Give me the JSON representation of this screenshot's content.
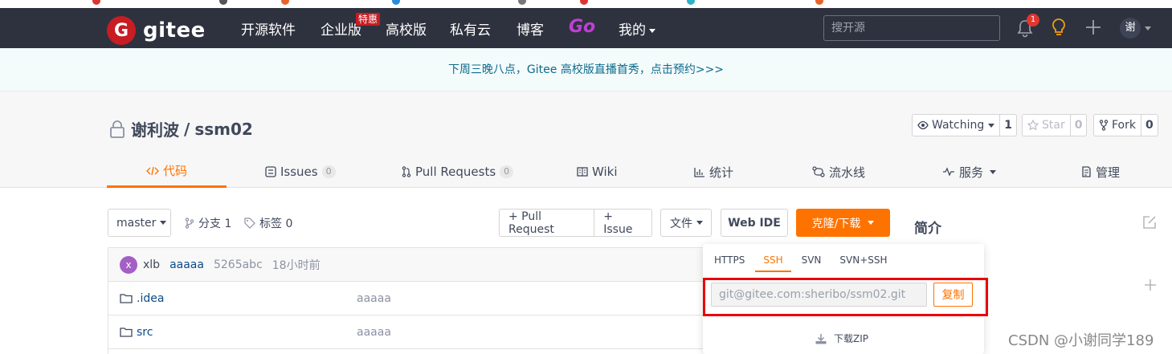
{
  "navbar": {
    "logo_mark": "G",
    "logo_text": "gitee",
    "items": [
      "开源软件",
      "企业版",
      "高校版",
      "私有云",
      "博客"
    ],
    "hot_badge": "特惠",
    "go_label": "Go",
    "mine_label": "我的",
    "search_placeholder": "搜开源",
    "notification_count": "1",
    "avatar_initial": "谢"
  },
  "banner": {
    "text": "下周三晚八点，Gitee 高校版直播首秀，点击预约>>>"
  },
  "repo": {
    "owner": "谢利波",
    "separator": "/",
    "name": "ssm02",
    "watching_label": "Watching",
    "watching_count": "1",
    "star_label": "Star",
    "star_count": "0",
    "fork_label": "Fork",
    "fork_count": "0"
  },
  "tabs": [
    {
      "label": "代码",
      "active": true,
      "icon": "code-icon"
    },
    {
      "label": "Issues",
      "count": "0",
      "icon": "issues-icon"
    },
    {
      "label": "Pull Requests",
      "count": "0",
      "icon": "pull-request-icon"
    },
    {
      "label": "Wiki",
      "icon": "wiki-icon"
    },
    {
      "label": "统计",
      "icon": "stats-icon"
    },
    {
      "label": "流水线",
      "icon": "pipeline-icon"
    },
    {
      "label": "服务",
      "icon": "service-icon"
    },
    {
      "label": "管理",
      "icon": "manage-icon"
    }
  ],
  "toolbar": {
    "branch": "master",
    "branches_label": "分支 1",
    "tags_label": "标签 0",
    "pull_request_btn": "+ Pull Request",
    "issue_btn": "+ Issue",
    "file_btn": "文件",
    "webide_btn": "Web IDE",
    "clone_btn": "克隆/下载"
  },
  "sidebar": {
    "intro_title": "简介"
  },
  "commit": {
    "avatar_initial": "x",
    "author": "xlb",
    "message": "aaaaa",
    "hash": "5265abc",
    "time": "18小时前"
  },
  "files": [
    {
      "name": ".idea",
      "message": "aaaaa"
    },
    {
      "name": "src",
      "message": "aaaaa"
    }
  ],
  "clone_dropdown": {
    "tabs": [
      "HTTPS",
      "SSH",
      "SVN",
      "SVN+SSH"
    ],
    "active_tab": "SSH",
    "url": "git@gitee.com:sheribo/ssm02.git",
    "copy_btn": "复制",
    "download_zip": "下载ZIP"
  },
  "watermark": "CSDN @小谢同学189",
  "colors": {
    "brand": "#c71d23",
    "accent": "#fe7300",
    "navbar": "#2e323e",
    "highlight_box": "#ea0000"
  }
}
